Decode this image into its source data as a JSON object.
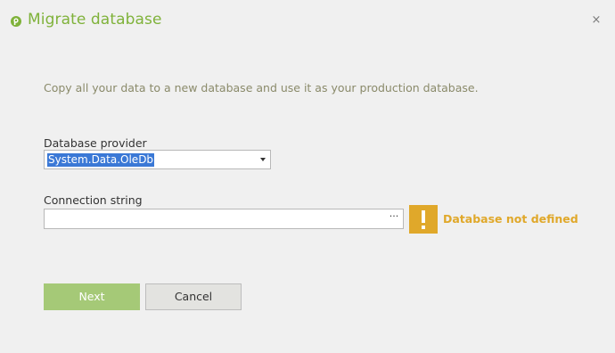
{
  "dialog": {
    "title": "Migrate database",
    "close_label": "×",
    "description": "Copy all your data to a new database and use it as your production database.",
    "provider": {
      "label": "Database provider",
      "selected": "System.Data.OleDb"
    },
    "connection": {
      "label": "Connection string",
      "value": "",
      "browse_label": "···"
    },
    "warning": {
      "text": "Database not defined"
    },
    "buttons": {
      "next": "Next",
      "cancel": "Cancel"
    }
  },
  "colors": {
    "accent": "#7fb23a",
    "warning": "#e0a82a",
    "next_button": "#a5c977",
    "selection": "#3a78d6"
  }
}
